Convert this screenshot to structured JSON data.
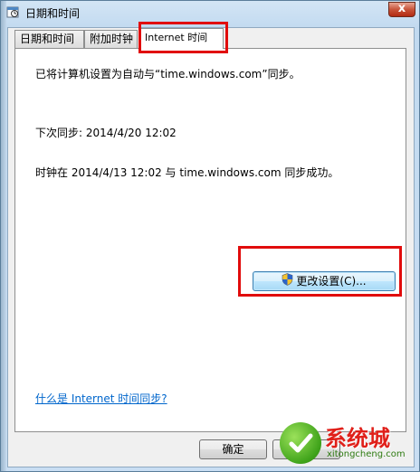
{
  "window": {
    "title": "日期和时间",
    "close_label": "x"
  },
  "tabs": [
    {
      "label": "日期和时间",
      "active": false
    },
    {
      "label": "附加时钟",
      "active": false
    },
    {
      "label": "Internet 时间",
      "active": true
    }
  ],
  "panel": {
    "sync_config_text": "已将计算机设置为自动与“time.windows.com”同步。",
    "next_sync_text": "下次同步: 2014/4/20 12:02",
    "last_sync_text": "时钟在 2014/4/13 12:02 与 time.windows.com 同步成功。",
    "change_settings_label": "更改设置(C)...",
    "help_link": "什么是 Internet 时间同步?"
  },
  "footer": {
    "ok_label": "确定"
  },
  "watermark": {
    "text": "系统城",
    "sub_text": "xitongcheng.com"
  },
  "colors": {
    "highlight_box": "#e10c0c",
    "link": "#0066cc"
  }
}
